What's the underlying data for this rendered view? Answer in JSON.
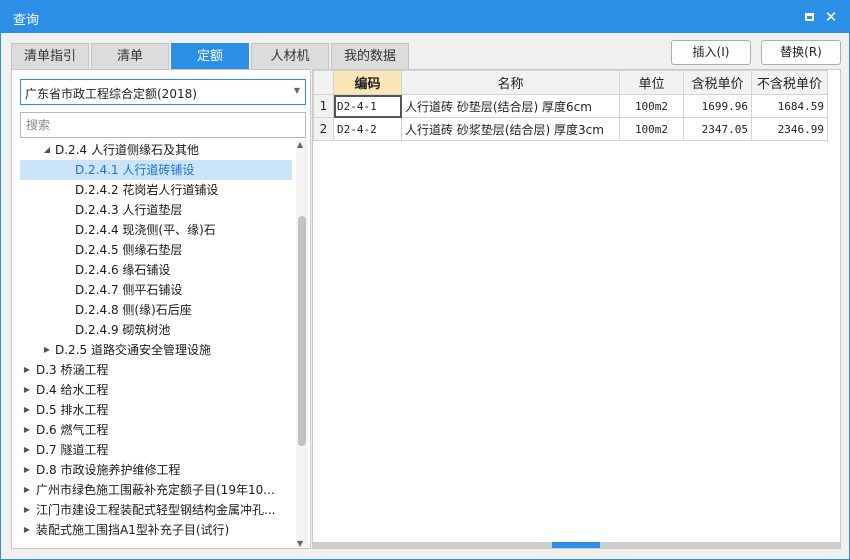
{
  "window": {
    "title": "查询"
  },
  "tabs": [
    {
      "label": "清单指引",
      "active": false
    },
    {
      "label": "清单",
      "active": false
    },
    {
      "label": "定额",
      "active": true
    },
    {
      "label": "人材机",
      "active": false
    },
    {
      "label": "我的数据",
      "active": false
    }
  ],
  "actions": {
    "insert_label": "插入(I)",
    "replace_label": "替换(R)"
  },
  "library_select": {
    "value": "广东省市政工程综合定额(2018)"
  },
  "search": {
    "placeholder": "搜索",
    "value": ""
  },
  "tree": [
    {
      "label": "D.2.4 人行道侧缘石及其他",
      "expanded": true,
      "level": 1,
      "selected": false
    },
    {
      "label": "D.2.4.1 人行道砖铺设",
      "level": 2,
      "selected": true
    },
    {
      "label": "D.2.4.2 花岗岩人行道铺设",
      "level": 2,
      "selected": false
    },
    {
      "label": "D.2.4.3 人行道垫层",
      "level": 2,
      "selected": false
    },
    {
      "label": "D.2.4.4 现浇侧(平、缘)石",
      "level": 2,
      "selected": false
    },
    {
      "label": "D.2.4.5 侧缘石垫层",
      "level": 2,
      "selected": false
    },
    {
      "label": "D.2.4.6 缘石铺设",
      "level": 2,
      "selected": false
    },
    {
      "label": "D.2.4.7 侧平石铺设",
      "level": 2,
      "selected": false
    },
    {
      "label": "D.2.4.8 侧(缘)石后座",
      "level": 2,
      "selected": false
    },
    {
      "label": "D.2.4.9 砌筑树池",
      "level": 2,
      "selected": false
    },
    {
      "label": "D.2.5 道路交通安全管理设施",
      "expanded": false,
      "level": 1,
      "selected": false
    },
    {
      "label": "D.3 桥涵工程",
      "expanded": false,
      "level": 0,
      "selected": false
    },
    {
      "label": "D.4 给水工程",
      "expanded": false,
      "level": 0,
      "selected": false
    },
    {
      "label": "D.5 排水工程",
      "expanded": false,
      "level": 0,
      "selected": false
    },
    {
      "label": "D.6 燃气工程",
      "expanded": false,
      "level": 0,
      "selected": false
    },
    {
      "label": "D.7 隧道工程",
      "expanded": false,
      "level": 0,
      "selected": false
    },
    {
      "label": "D.8 市政设施养护维修工程",
      "expanded": false,
      "level": 0,
      "selected": false
    },
    {
      "label": "广州市绿色施工围蔽补充定额子目(19年10...",
      "expanded": false,
      "level": 0,
      "selected": false
    },
    {
      "label": "江门市建设工程装配式轻型钢结构金属冲孔...",
      "expanded": false,
      "level": 0,
      "selected": false
    },
    {
      "label": "装配式施工围挡A1型补充子目(试行)",
      "expanded": false,
      "level": 0,
      "selected": false
    }
  ],
  "grid": {
    "columns": [
      "编码",
      "名称",
      "单位",
      "含税单价",
      "不含税单价"
    ],
    "rows": [
      {
        "no": "1",
        "code": "D2-4-1",
        "name": "人行道砖 砂垫层(结合层) 厚度6cm",
        "unit": "100m2",
        "price_tax": "1699.96",
        "price_notax": "1684.59"
      },
      {
        "no": "2",
        "code": "D2-4-2",
        "name": "人行道砖 砂浆垫层(结合层) 厚度3cm",
        "unit": "100m2",
        "price_tax": "2347.05",
        "price_notax": "2346.99"
      }
    ]
  },
  "icons": {
    "maximize": "maximize-icon",
    "close": "close-icon",
    "dropdown": "chevron-down-icon",
    "expand": "triangle-right-icon",
    "collapse": "triangle-down-icon"
  },
  "colors": {
    "accent": "#2b8fe8",
    "selected_row": "#cce4f7",
    "code_header": "#fbe6b8"
  }
}
